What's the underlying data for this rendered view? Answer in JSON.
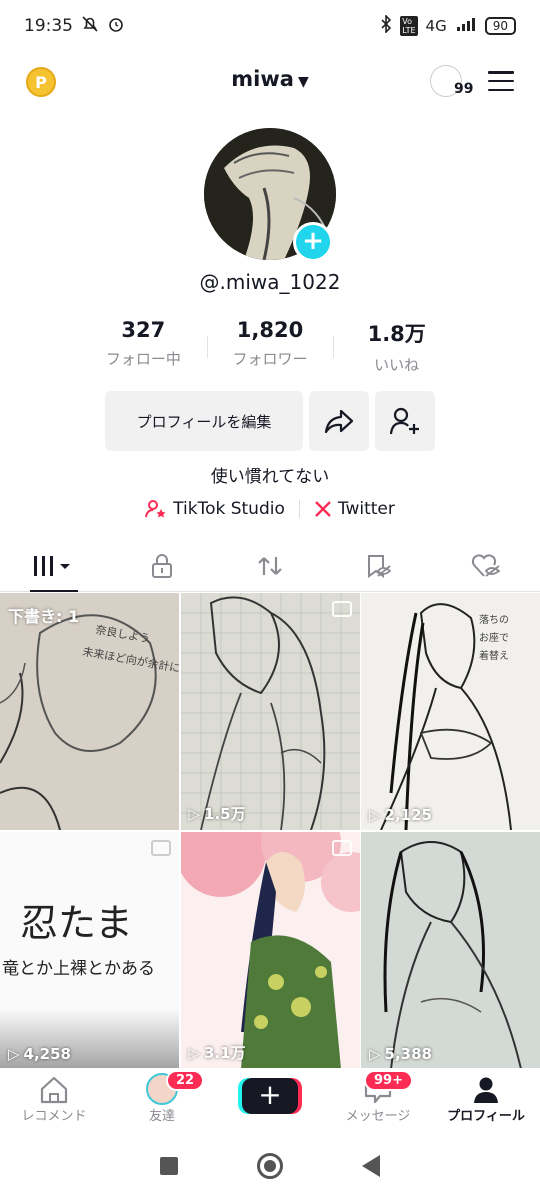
{
  "status_bar": {
    "time": "19:35",
    "network": "4G",
    "battery": "90"
  },
  "header": {
    "username": "miwa",
    "notification_count": "99"
  },
  "profile": {
    "handle": "@.miwa_1022",
    "stats": [
      {
        "value": "327",
        "label": "フォロー中"
      },
      {
        "value": "1,820",
        "label": "フォロワー"
      },
      {
        "value": "1.8万",
        "label": "いいね"
      }
    ],
    "edit_button": "プロフィールを編集",
    "bio": "使い慣れてない",
    "links": [
      {
        "label": "TikTok Studio"
      },
      {
        "label": "Twitter"
      }
    ]
  },
  "videos": [
    {
      "label": "",
      "draft": "下書き: 1"
    },
    {
      "label": "1.5万"
    },
    {
      "label": "2,125"
    },
    {
      "label": "4,258",
      "text_line1": "忍たま",
      "text_line2": "竜とか上裸とかある"
    },
    {
      "label": "3.1万"
    },
    {
      "label": "5,388"
    }
  ],
  "bottom_nav": [
    {
      "label": "レコメンド"
    },
    {
      "label": "友達",
      "badge": "22"
    },
    {
      "label": ""
    },
    {
      "label": "メッセージ",
      "badge": "99+"
    },
    {
      "label": "プロフィール"
    }
  ],
  "colors": {
    "accent": "#fe2c55",
    "cyan": "#20d5ec",
    "text": "#161823"
  }
}
